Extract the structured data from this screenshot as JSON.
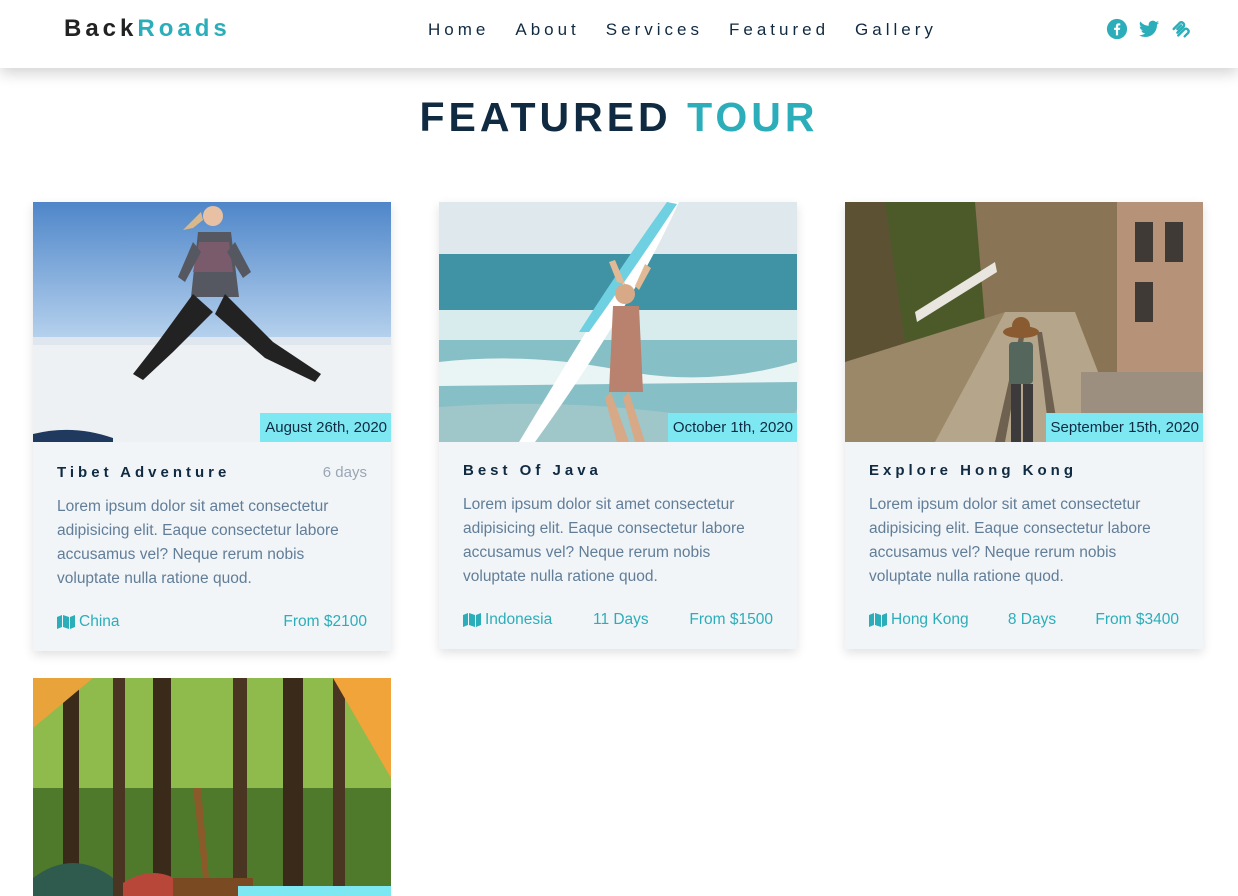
{
  "brand": {
    "part1": "Back",
    "part2": "Roads"
  },
  "nav": {
    "links": [
      "Home",
      "About",
      "Services",
      "Featured",
      "Gallery"
    ],
    "socials": [
      "facebook-icon",
      "twitter-icon",
      "squarespace-icon"
    ]
  },
  "section": {
    "title_main": "FEATURED",
    "title_accent": "TOUR"
  },
  "tours": [
    {
      "date": "August 26th, 2020",
      "name": "Tibet Adventure",
      "days": "6 days",
      "description": "Lorem ipsum dolor sit amet consectetur adipisicing elit. Eaque consectetur labore accusamus vel? Neque rerum nobis voluptate nulla ratione quod.",
      "country": "China",
      "price": "From $2100"
    },
    {
      "date": "October 1th, 2020",
      "name": "Best Of Java",
      "description": "Lorem ipsum dolor sit amet consectetur adipisicing elit. Eaque consectetur labore accusamus vel? Neque rerum nobis voluptate nulla ratione quod.",
      "country": "Indonesia",
      "duration": "11 Days",
      "price": "From $1500"
    },
    {
      "date": "September 15th, 2020",
      "name": "Explore Hong Kong",
      "description": "Lorem ipsum dolor sit amet consectetur adipisicing elit. Eaque consectetur labore accusamus vel? Neque rerum nobis voluptate nulla ratione quod.",
      "country": "Hong Kong",
      "duration": "8 Days",
      "price": "From $3400"
    }
  ],
  "colors": {
    "accent": "#2caeba",
    "date_badge": "#7ee8f2",
    "dark": "#102a42",
    "card_bg": "#f1f5f8"
  }
}
